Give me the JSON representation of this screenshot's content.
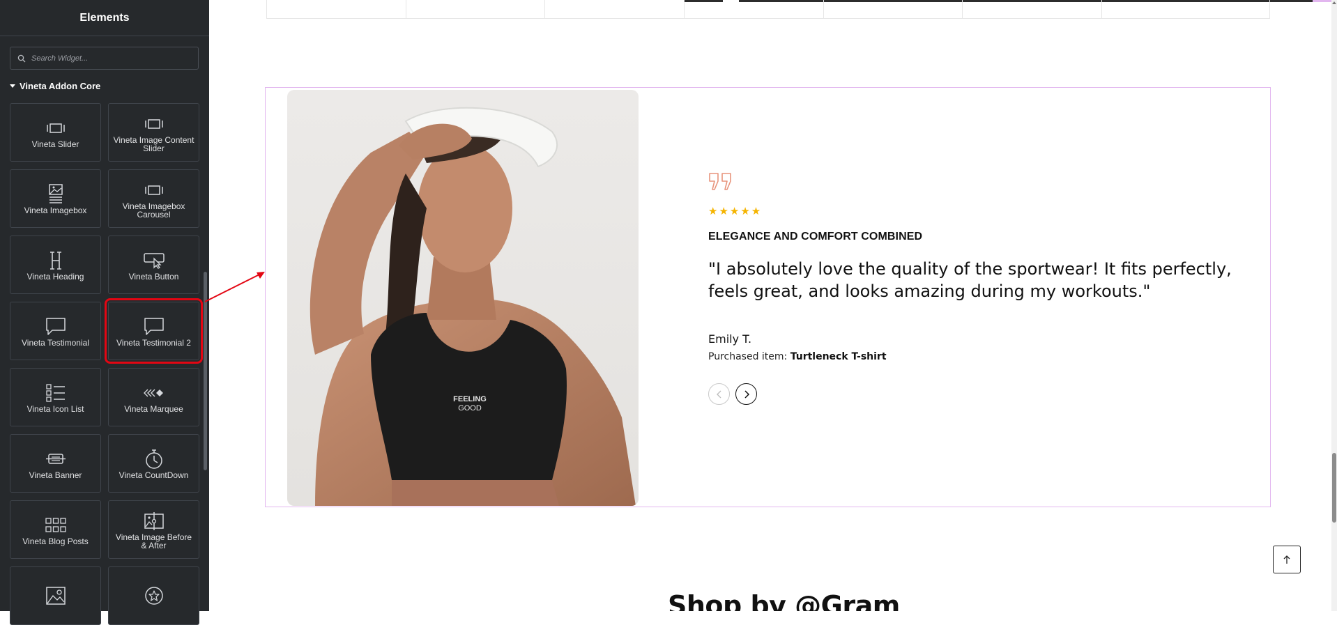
{
  "sidebar": {
    "title": "Elements",
    "search": {
      "placeholder": "Search Widget..."
    },
    "category": "Vineta Addon Core",
    "widgets": [
      {
        "label": "Vineta Slider",
        "icon": "slider-icon"
      },
      {
        "label": "Vineta Image Content Slider",
        "icon": "slider-icon"
      },
      {
        "label": "Vineta Imagebox",
        "icon": "imagebox-icon"
      },
      {
        "label": "Vineta Imagebox Carousel",
        "icon": "slider-icon"
      },
      {
        "label": "Vineta Heading",
        "icon": "heading-icon"
      },
      {
        "label": "Vineta Button",
        "icon": "button-icon"
      },
      {
        "label": "Vineta Testimonial",
        "icon": "testimonial-icon"
      },
      {
        "label": "Vineta Testimonial 2",
        "icon": "testimonial-icon",
        "highlighted": true
      },
      {
        "label": "Vineta Icon List",
        "icon": "icon-list-icon"
      },
      {
        "label": "Vineta Marquee",
        "icon": "marquee-icon"
      },
      {
        "label": "Vineta Banner",
        "icon": "banner-icon"
      },
      {
        "label": "Vineta CountDown",
        "icon": "countdown-icon"
      },
      {
        "label": "Vineta Blog Posts",
        "icon": "blog-posts-icon"
      },
      {
        "label": "Vineta Image Before & After",
        "icon": "before-after-icon"
      },
      {
        "label": "",
        "icon": "map-image-icon"
      },
      {
        "label": "",
        "icon": "star-circle-icon"
      }
    ]
  },
  "testimonial": {
    "stars": "★★★★★",
    "rating": 5,
    "title": "ELEGANCE AND COMFORT COMBINED",
    "quote": "\"I absolutely love the quality of the sportwear! It fits perfectly, feels great, and looks amazing during my workouts.\"",
    "author": "Emily T.",
    "purchase_label": "Purchased item:",
    "purchase_item": "Turtleneck T-shirt",
    "shirt_text_1": "FEELING",
    "shirt_text_2": "GOOD"
  },
  "shop": {
    "heading": "Shop by @Gram"
  },
  "colors": {
    "sidebar_bg": "#26292c",
    "highlight": "#e30613",
    "section_border": "#e2b6ef",
    "quote_icon": "#e8947c",
    "stars": "#f5b400"
  }
}
